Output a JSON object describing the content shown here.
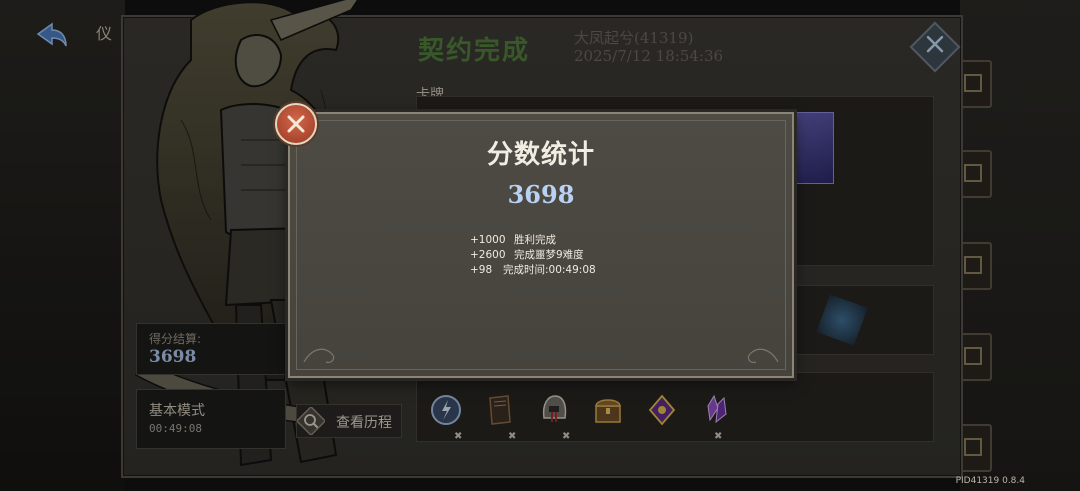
{
  "top": {
    "title": "仪"
  },
  "window": {
    "title": "契约完成",
    "user": "大凤起兮(41319)",
    "datetime": "2025/7/12 18:54:36"
  },
  "cards_section": {
    "label": "卡牌"
  },
  "left_panel": {
    "score_label": "得分结算:",
    "score_value": "3698",
    "mode_label": "基本模式",
    "mode_time": "00:49:08",
    "history_button": "查看历程"
  },
  "modal": {
    "title": "分数统计",
    "score": "3698",
    "breakdown": [
      {
        "amount": "+1000",
        "label": "胜利完成"
      },
      {
        "amount": "+2600",
        "label": "完成噩梦9难度"
      },
      {
        "amount": "+98",
        "label": "完成时间:00:49:08"
      }
    ]
  },
  "items": [
    {
      "icon": "blue-orb-icon"
    },
    {
      "icon": "dark-book-icon"
    },
    {
      "icon": "helmet-icon"
    },
    {
      "icon": "treasure-chest-icon"
    },
    {
      "icon": "purple-emblem-icon"
    },
    {
      "icon": "purple-crystal-icon"
    }
  ],
  "footer": {
    "version": "PID41319  0.8.4"
  },
  "colors": {
    "accent_green": "#4f7a3a",
    "score_blue": "#b9d2f3",
    "close_red": "#c2553a"
  }
}
